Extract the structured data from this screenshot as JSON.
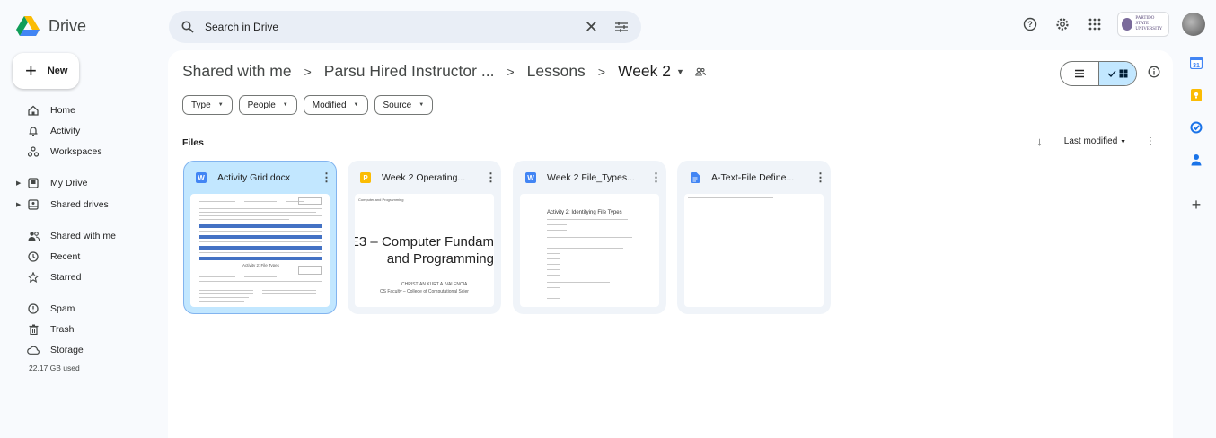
{
  "app": {
    "name": "Drive"
  },
  "search": {
    "placeholder": "Search in Drive"
  },
  "org_badge": {
    "line1": "PARTIDO STATE",
    "line2": "UNIVERSITY"
  },
  "sidebar": {
    "new_label": "New",
    "items": [
      {
        "label": "Home",
        "icon": "home-icon"
      },
      {
        "label": "Activity",
        "icon": "bell-icon"
      },
      {
        "label": "Workspaces",
        "icon": "workspaces-icon"
      },
      {
        "label": "My Drive",
        "icon": "my-drive-icon"
      },
      {
        "label": "Shared drives",
        "icon": "shared-drives-icon"
      },
      {
        "label": "Shared with me",
        "icon": "people-icon"
      },
      {
        "label": "Recent",
        "icon": "clock-icon"
      },
      {
        "label": "Starred",
        "icon": "star-icon"
      },
      {
        "label": "Spam",
        "icon": "spam-icon"
      },
      {
        "label": "Trash",
        "icon": "trash-icon"
      },
      {
        "label": "Storage",
        "icon": "cloud-icon"
      }
    ],
    "storage_used": "22.17 GB used"
  },
  "breadcrumb": {
    "items": [
      "Shared with me",
      "Parsu Hired Instructor ...",
      "Lessons",
      "Week 2"
    ],
    "separator": ">"
  },
  "filters": [
    "Type",
    "People",
    "Modified",
    "Source"
  ],
  "files_heading": "Files",
  "sort": {
    "label": "Last modified"
  },
  "files": [
    {
      "title": "Activity Grid.docx",
      "type": "word",
      "type_letter": "W",
      "color": "#4285f4",
      "selected": true
    },
    {
      "title": "Week 2 Operating...",
      "type": "slides",
      "type_letter": "P",
      "color": "#fbbc04",
      "selected": false
    },
    {
      "title": "Week 2 File_Types...",
      "type": "word",
      "type_letter": "W",
      "color": "#4285f4",
      "selected": false
    },
    {
      "title": "A-Text-File Define...",
      "type": "docs",
      "type_letter": "",
      "color": "#4285f4",
      "selected": false
    }
  ],
  "thumbs": {
    "slide_header": "Computer and Programming",
    "slide_title_1": "E3 – Computer Fundam",
    "slide_title_2": "and Programming",
    "slide_author": "CHRISTIAN KURT A. VALENCIA",
    "slide_affil": "CS Faculty – College of Computational Scier",
    "activity_heading": "Activity 2: Identifying File Types",
    "grid_mid_title": "Activity 2: File Types"
  },
  "colors": {
    "accent": "#0b57d0",
    "selected_bg": "#c2e7ff",
    "doc_blue": "#4285f4",
    "slides_yellow": "#fbbc04",
    "table_blue": "#4472c4"
  }
}
